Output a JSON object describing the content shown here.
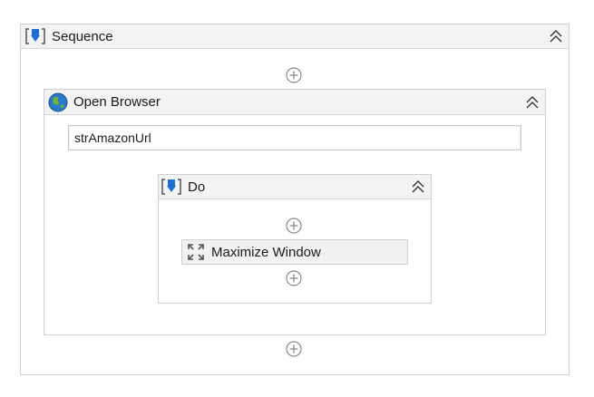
{
  "sequence": {
    "title": "Sequence",
    "icon": "sequence-icon"
  },
  "open_browser": {
    "title": "Open Browser",
    "icon": "globe-icon",
    "url_value": "strAmazonUrl"
  },
  "do_block": {
    "title": "Do",
    "icon": "sequence-icon"
  },
  "maximize": {
    "title": "Maximize Window",
    "icon": "maximize-window-icon"
  },
  "colors": {
    "header_bg": "#f3f3f3",
    "border": "#cfcfcf",
    "icon_blue": "#1d6fd1"
  }
}
